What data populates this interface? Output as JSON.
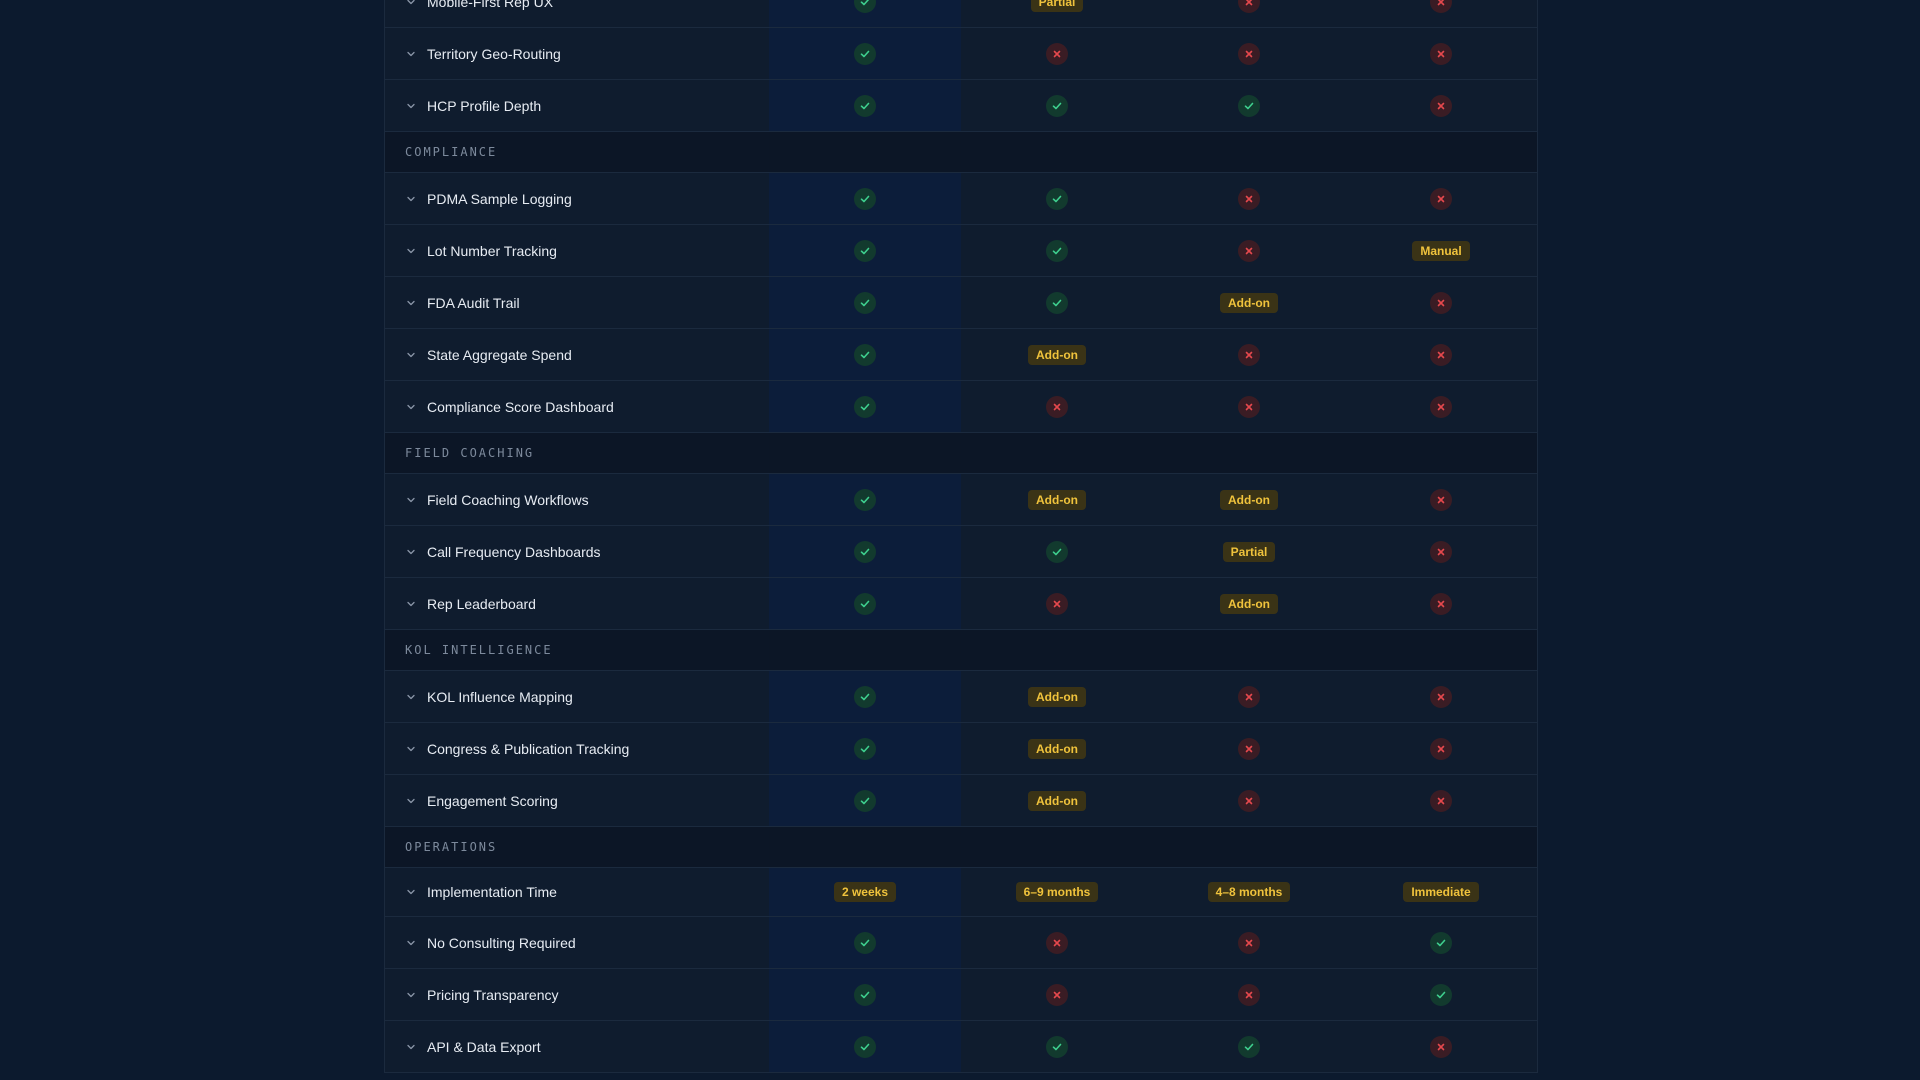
{
  "colors": {
    "background": "#0c1a2e",
    "check": "#3ecf8e",
    "cross": "#e5484d",
    "badge_text": "#f0c33c"
  },
  "rows": [
    {
      "type": "feature",
      "label": "Mobile-First Rep UX",
      "values": [
        {
          "kind": "check"
        },
        {
          "kind": "badge",
          "text": "Partial"
        },
        {
          "kind": "cross"
        },
        {
          "kind": "cross"
        }
      ]
    },
    {
      "type": "feature",
      "label": "Territory Geo-Routing",
      "values": [
        {
          "kind": "check"
        },
        {
          "kind": "cross"
        },
        {
          "kind": "cross"
        },
        {
          "kind": "cross"
        }
      ]
    },
    {
      "type": "feature",
      "label": "HCP Profile Depth",
      "values": [
        {
          "kind": "check"
        },
        {
          "kind": "check"
        },
        {
          "kind": "check"
        },
        {
          "kind": "cross"
        }
      ]
    },
    {
      "type": "section",
      "label": "COMPLIANCE"
    },
    {
      "type": "feature",
      "label": "PDMA Sample Logging",
      "values": [
        {
          "kind": "check"
        },
        {
          "kind": "check"
        },
        {
          "kind": "cross"
        },
        {
          "kind": "cross"
        }
      ]
    },
    {
      "type": "feature",
      "label": "Lot Number Tracking",
      "values": [
        {
          "kind": "check"
        },
        {
          "kind": "check"
        },
        {
          "kind": "cross"
        },
        {
          "kind": "badge",
          "text": "Manual"
        }
      ]
    },
    {
      "type": "feature",
      "label": "FDA Audit Trail",
      "values": [
        {
          "kind": "check"
        },
        {
          "kind": "check"
        },
        {
          "kind": "badge",
          "text": "Add-on"
        },
        {
          "kind": "cross"
        }
      ]
    },
    {
      "type": "feature",
      "label": "State Aggregate Spend",
      "values": [
        {
          "kind": "check"
        },
        {
          "kind": "badge",
          "text": "Add-on"
        },
        {
          "kind": "cross"
        },
        {
          "kind": "cross"
        }
      ]
    },
    {
      "type": "feature",
      "label": "Compliance Score Dashboard",
      "values": [
        {
          "kind": "check"
        },
        {
          "kind": "cross"
        },
        {
          "kind": "cross"
        },
        {
          "kind": "cross"
        }
      ]
    },
    {
      "type": "section",
      "label": "FIELD COACHING"
    },
    {
      "type": "feature",
      "label": "Field Coaching Workflows",
      "values": [
        {
          "kind": "check"
        },
        {
          "kind": "badge",
          "text": "Add-on"
        },
        {
          "kind": "badge",
          "text": "Add-on"
        },
        {
          "kind": "cross"
        }
      ]
    },
    {
      "type": "feature",
      "label": "Call Frequency Dashboards",
      "values": [
        {
          "kind": "check"
        },
        {
          "kind": "check"
        },
        {
          "kind": "badge",
          "text": "Partial"
        },
        {
          "kind": "cross"
        }
      ]
    },
    {
      "type": "feature",
      "label": "Rep Leaderboard",
      "values": [
        {
          "kind": "check"
        },
        {
          "kind": "cross"
        },
        {
          "kind": "badge",
          "text": "Add-on"
        },
        {
          "kind": "cross"
        }
      ]
    },
    {
      "type": "section",
      "label": "KOL INTELLIGENCE"
    },
    {
      "type": "feature",
      "label": "KOL Influence Mapping",
      "values": [
        {
          "kind": "check"
        },
        {
          "kind": "badge",
          "text": "Add-on"
        },
        {
          "kind": "cross"
        },
        {
          "kind": "cross"
        }
      ]
    },
    {
      "type": "feature",
      "label": "Congress & Publication Tracking",
      "values": [
        {
          "kind": "check"
        },
        {
          "kind": "badge",
          "text": "Add-on"
        },
        {
          "kind": "cross"
        },
        {
          "kind": "cross"
        }
      ]
    },
    {
      "type": "feature",
      "label": "Engagement Scoring",
      "values": [
        {
          "kind": "check"
        },
        {
          "kind": "badge",
          "text": "Add-on"
        },
        {
          "kind": "cross"
        },
        {
          "kind": "cross"
        }
      ]
    },
    {
      "type": "section",
      "label": "OPERATIONS"
    },
    {
      "type": "feature",
      "tall": true,
      "label": "Implementation Time",
      "values": [
        {
          "kind": "badge",
          "text": "2 weeks"
        },
        {
          "kind": "badge",
          "text": "6–9 months"
        },
        {
          "kind": "badge",
          "text": "4–8 months"
        },
        {
          "kind": "badge",
          "text": "Immediate"
        }
      ]
    },
    {
      "type": "feature",
      "label": "No Consulting Required",
      "values": [
        {
          "kind": "check"
        },
        {
          "kind": "cross"
        },
        {
          "kind": "cross"
        },
        {
          "kind": "check"
        }
      ]
    },
    {
      "type": "feature",
      "label": "Pricing Transparency",
      "values": [
        {
          "kind": "check"
        },
        {
          "kind": "cross"
        },
        {
          "kind": "cross"
        },
        {
          "kind": "check"
        }
      ]
    },
    {
      "type": "feature",
      "label": "API & Data Export",
      "values": [
        {
          "kind": "check"
        },
        {
          "kind": "check"
        },
        {
          "kind": "check"
        },
        {
          "kind": "cross"
        }
      ]
    }
  ]
}
